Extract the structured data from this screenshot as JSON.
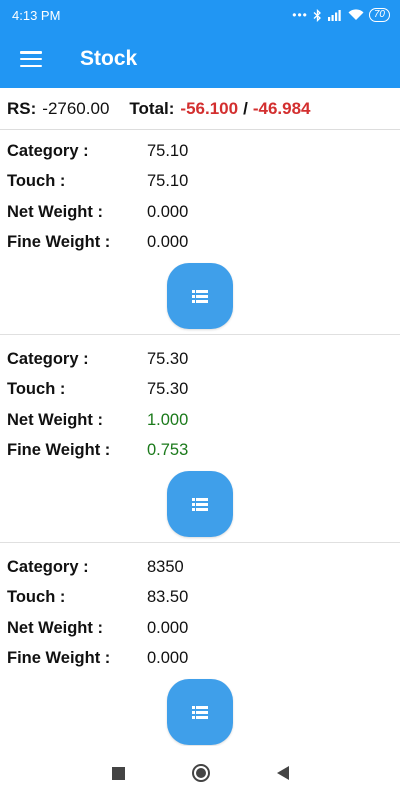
{
  "status": {
    "time": "4:13 PM",
    "dots": "•••",
    "battery": "70"
  },
  "appbar": {
    "title": "Stock"
  },
  "totals": {
    "rs_label": "RS:",
    "rs_value": "-2760.00",
    "total_label": "Total:",
    "total_value_1": "-56.100",
    "separator": "/",
    "total_value_2": "-46.984"
  },
  "labels": {
    "category": "Category :",
    "touch": "Touch :",
    "net_weight": "Net Weight :",
    "fine_weight": "Fine Weight :"
  },
  "items": [
    {
      "category": "75.10",
      "touch": "75.10",
      "net_weight": "0.000",
      "fine_weight": "0.000"
    },
    {
      "category": "75.30",
      "touch": "75.30",
      "net_weight": "1.000",
      "fine_weight": "0.753"
    },
    {
      "category": "8350",
      "touch": "83.50",
      "net_weight": "0.000",
      "fine_weight": "0.000"
    }
  ],
  "colors": {
    "primary": "#2196F3",
    "button": "#3f9fea",
    "negative": "#d32f2f",
    "positive": "#1b7a1b"
  },
  "icons": {
    "menu": "hamburger-icon",
    "list": "list-icon",
    "bluetooth": "bluetooth-icon",
    "signal": "signal-icon",
    "wifi": "wifi-icon"
  }
}
